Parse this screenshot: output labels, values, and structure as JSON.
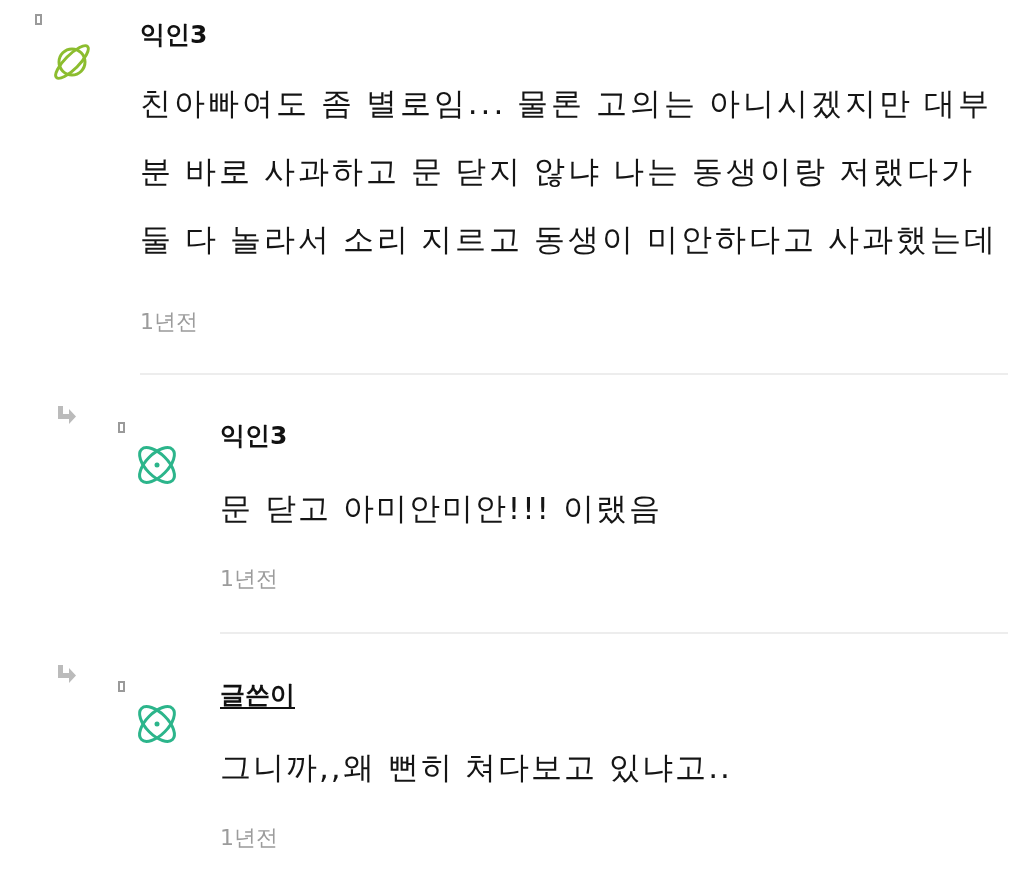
{
  "comments": [
    {
      "author": "익인3",
      "writer": false,
      "avatar": {
        "kind": "planet"
      },
      "text": "친아빠여도 좀 별로임... 물론 고의는 아니시겠지만 대부분 바로 사과하고 문 닫지 않냐 나는 동생이랑 저랬다가 둘 다 놀라서 소리 지르고 동생이 미안하다고 사과했는데",
      "time": "1년전",
      "replies": [
        {
          "author": "익인3",
          "writer": false,
          "avatar": {
            "kind": "atom"
          },
          "text": "문 닫고 아미안미안!!! 이랬음",
          "time": "1년전"
        },
        {
          "author": "글쓴이",
          "writer": true,
          "avatar": {
            "kind": "atom"
          },
          "text": "그니까,,왜 뻔히 쳐다보고 있냐고..",
          "time": "1년전"
        }
      ]
    }
  ]
}
